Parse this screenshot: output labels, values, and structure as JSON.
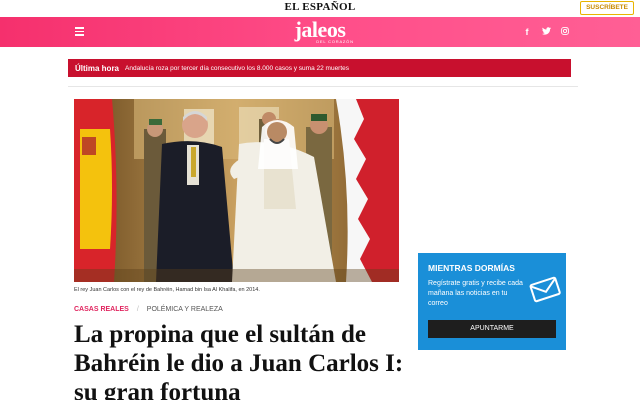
{
  "topbar": {
    "brand": "EL ESPAÑOL",
    "subscribe_label": "SUSCRÍBETE"
  },
  "header": {
    "logo": "jaleos",
    "logo_sub": "DEL CORAZÓN",
    "social": [
      {
        "icon": "facebook-icon",
        "glyph": "f"
      },
      {
        "icon": "twitter-icon",
        "glyph": "🐦"
      },
      {
        "icon": "instagram-icon",
        "glyph": "◎"
      }
    ]
  },
  "breaking": {
    "label": "Última hora",
    "text": "Andalucía roza por tercer día consecutivo los 8.000 casos y suma 22 muertes"
  },
  "article": {
    "caption": "El rey Juan Carlos con el rey de Bahréin, Hamad bin Isa Al Khalifa, en 2014.",
    "category": "CASAS REALES",
    "separator": "/",
    "subcategory": "POLÉMICA Y REALEZA",
    "headline": "La propina que el sultán de Bahréin le dio a Juan Carlos I: su gran fortuna"
  },
  "promo": {
    "title": "MIENTRAS DORMÍAS",
    "text": "Regístrate gratis y recibe cada mañana las noticias en tu correo",
    "button": "APUNTARME"
  },
  "colors": {
    "pink": "#f5306d",
    "breaking": "#c8102e",
    "promo": "#1a8fd8",
    "category": "#e0245e"
  }
}
